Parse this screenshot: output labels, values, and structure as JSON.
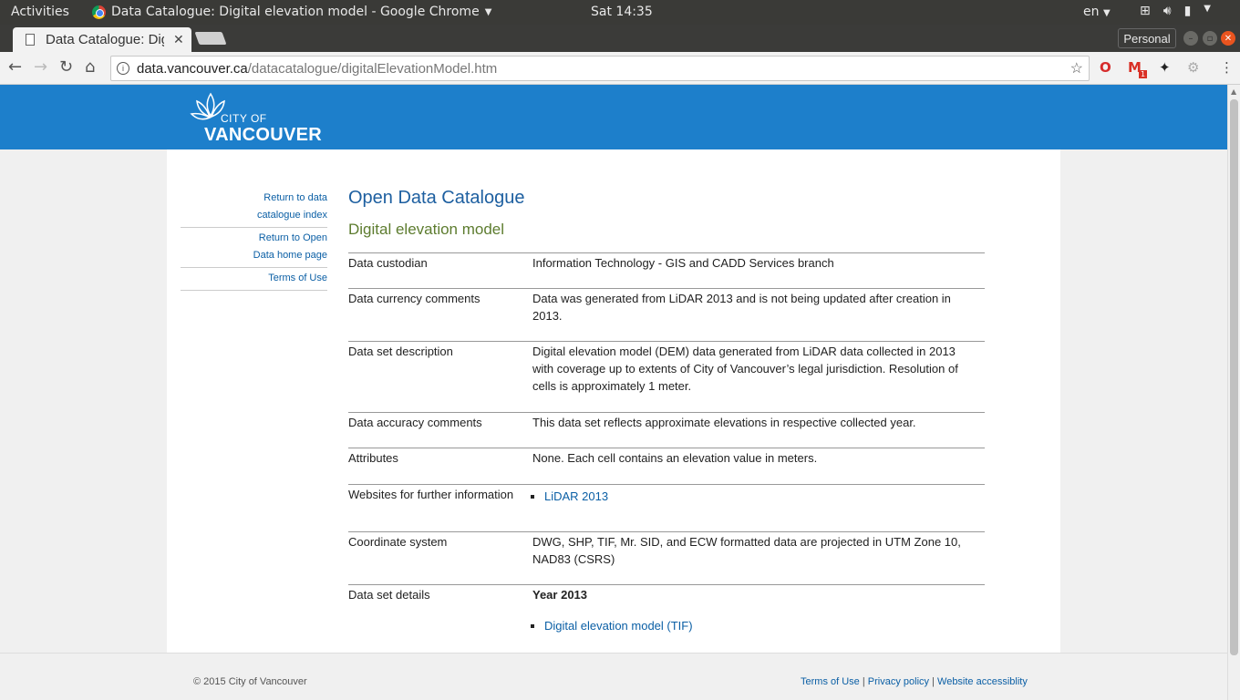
{
  "topbar": {
    "activities": "Activities",
    "app_title": "Data Catalogue: Digital elevation model - Google Chrome",
    "clock": "Sat 14:35",
    "lang": "en"
  },
  "browser": {
    "tab_title": "Data Catalogue: Digital elevation model",
    "profile": "Personal",
    "url_host": "data.vancouver.ca",
    "url_path": "/datacatalogue/digitalElevationModel.htm",
    "gmail_badge": "1"
  },
  "logo": {
    "line1": "CITY OF",
    "line2": "VANCOUVER"
  },
  "sidenav": {
    "items": [
      "Return to data catalogue index",
      "Return to Open Data home page",
      "Terms of Use"
    ]
  },
  "main": {
    "title": "Open Data Catalogue",
    "subtitle": "Digital elevation model",
    "rows": [
      {
        "label": "Data custodian",
        "value": "Information Technology - GIS and CADD Services branch"
      },
      {
        "label": "Data currency comments",
        "value": "Data was generated from LiDAR 2013 and is not being updated after creation in 2013."
      },
      {
        "label": "Data set description",
        "value": "Digital elevation model (DEM) data generated from LiDAR data collected in 2013 with coverage up to extents of City of Vancouver’s legal jurisdiction. Resolution of cells is approximately 1 meter."
      },
      {
        "label": "Data accuracy comments",
        "value": "This data set reflects approximate elevations in respective collected year."
      },
      {
        "label": "Attributes",
        "value": "None. Each cell contains an elevation value in meters."
      },
      {
        "label": "Websites for further information",
        "link": "LiDAR 2013"
      },
      {
        "label": "Coordinate system",
        "value": "DWG, SHP, TIF, Mr. SID, and ECW formatted data are projected in UTM Zone 10, NAD83 (CSRS)"
      },
      {
        "label": "Data set details",
        "year": "Year 2013",
        "link": "Digital elevation model (TIF)"
      }
    ]
  },
  "footer": {
    "copyright": "© 2015 City of Vancouver",
    "links": [
      "Terms of Use",
      "Privacy policy",
      "Website accessiblity"
    ],
    "separator": "|"
  }
}
